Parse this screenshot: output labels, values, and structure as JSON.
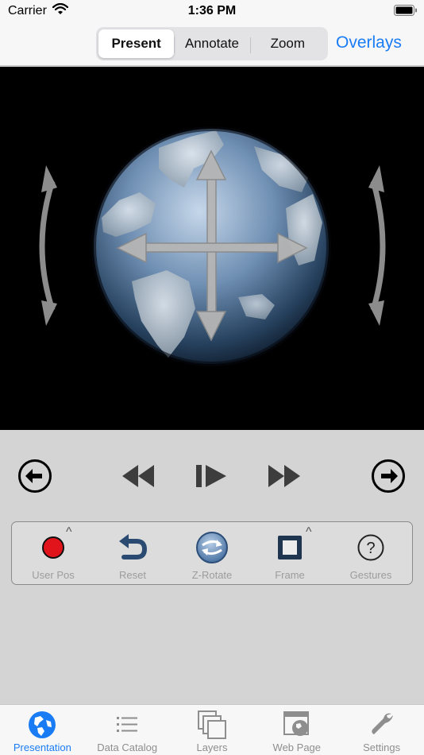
{
  "status_bar": {
    "carrier": "Carrier",
    "time": "1:36 PM"
  },
  "nav": {
    "segments": [
      {
        "label": "Present",
        "selected": true
      },
      {
        "label": "Annotate",
        "selected": false
      },
      {
        "label": "Zoom",
        "selected": false
      }
    ],
    "overlays_label": "Overlays"
  },
  "viewer": {
    "content_icon": "globe-with-pan-arrows-icon",
    "side_icons": [
      "curved-double-arrow-icon",
      "curved-double-arrow-icon"
    ]
  },
  "playback": {
    "buttons": [
      "previous-circle-icon",
      "rewind-icon",
      "step-play-icon",
      "fast-forward-icon",
      "next-circle-icon"
    ]
  },
  "tools": [
    {
      "label": "User Pos",
      "icon": "red-dot-icon",
      "has_caret": true
    },
    {
      "label": "Reset",
      "icon": "undo-arrow-icon",
      "has_caret": false
    },
    {
      "label": "Z-Rotate",
      "icon": "rotate-circle-icon",
      "has_caret": false
    },
    {
      "label": "Frame",
      "icon": "frame-square-icon",
      "has_caret": true
    },
    {
      "label": "Gestures",
      "icon": "question-circle-icon",
      "has_caret": false
    }
  ],
  "tabs": [
    {
      "label": "Presentation",
      "icon": "globe-icon",
      "active": true
    },
    {
      "label": "Data Catalog",
      "icon": "list-icon",
      "active": false
    },
    {
      "label": "Layers",
      "icon": "layers-icon",
      "active": false
    },
    {
      "label": "Web Page",
      "icon": "web-page-icon",
      "active": false
    },
    {
      "label": "Settings",
      "icon": "wrench-icon",
      "active": false
    }
  ],
  "colors": {
    "accent": "#1a7cf5",
    "user_pos_dot": "#e0141a",
    "tab_inactive": "#8e8e8e"
  },
  "caret_glyph": "^"
}
